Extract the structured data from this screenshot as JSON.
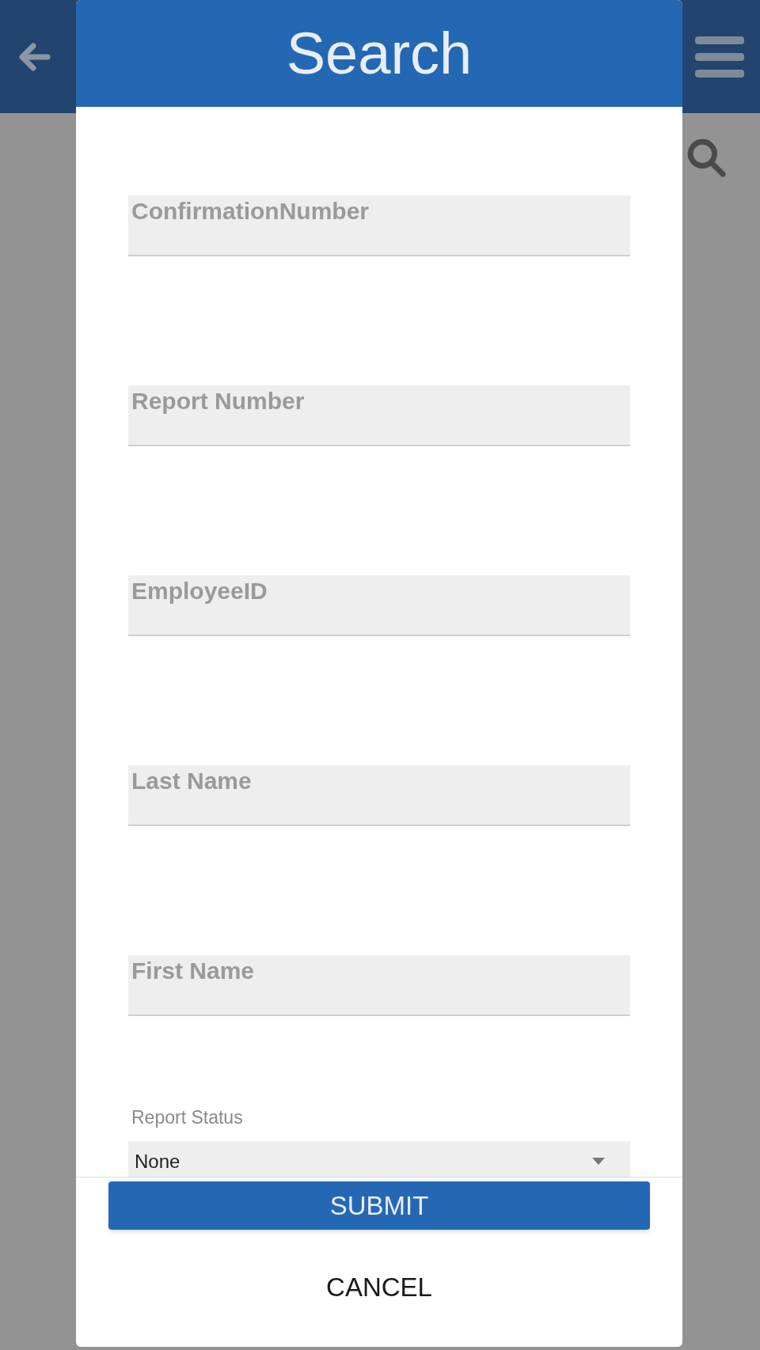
{
  "dialog": {
    "title": "Search",
    "fields": [
      {
        "placeholder": "ConfirmationNumber"
      },
      {
        "placeholder": "Report Number"
      },
      {
        "placeholder": "EmployeeID"
      },
      {
        "placeholder": "Last Name"
      },
      {
        "placeholder": "First Name"
      }
    ],
    "select": {
      "label": "Report Status",
      "value": "None"
    },
    "buttons": [
      {
        "label": "SUBMIT",
        "kind": "primary"
      },
      {
        "label": "CANCEL",
        "kind": "text"
      }
    ]
  }
}
